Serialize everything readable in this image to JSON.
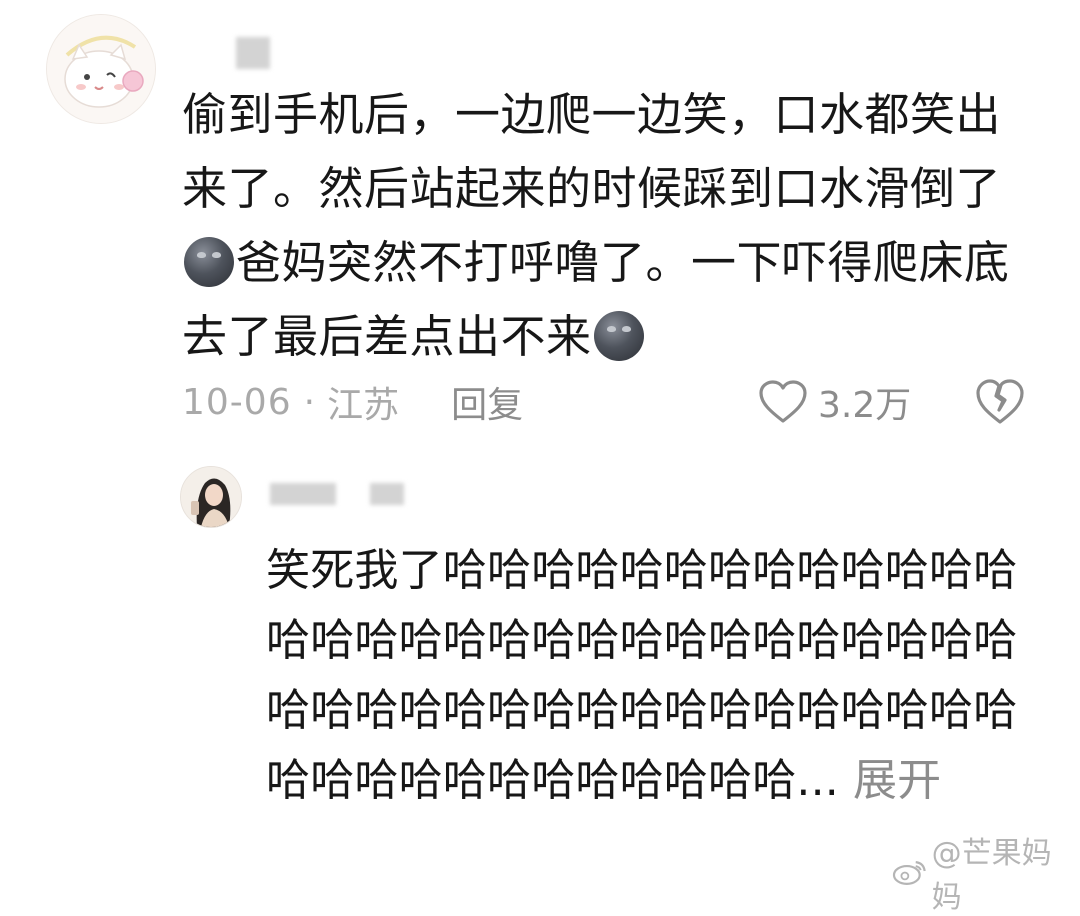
{
  "main_comment": {
    "line1": "偷到手机后，一边爬一边笑，口水都笑出",
    "line2": "来了。然后站起来的时候踩到口水滑倒了",
    "line3": "爸妈突然不打呼噜了。一下吓得爬床底",
    "line4": "去了最后差点出不来",
    "date": "10-06",
    "separator": "·",
    "location": "江苏",
    "reply_label": "回复",
    "like_count": "3.2万",
    "emoji": "new-moon-face-emoji"
  },
  "reply": {
    "text": "笑死我了哈哈哈哈哈哈哈哈哈哈哈哈哈哈哈哈哈哈哈哈哈哈哈哈哈哈哈哈哈哈哈哈哈哈哈哈哈哈哈哈哈哈哈哈哈哈哈哈哈哈哈哈哈哈哈哈哈哈哈...",
    "expand_label": "展开"
  },
  "watermark": {
    "text": "@芒果妈妈"
  },
  "colors": {
    "text": "#171717",
    "meta": "#a9a9a9",
    "icon": "#8c8c8c"
  }
}
